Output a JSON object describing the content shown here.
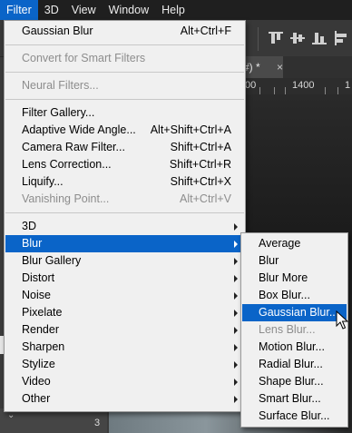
{
  "menubar": {
    "items": [
      {
        "label": "Filter",
        "active": true
      },
      {
        "label": "3D"
      },
      {
        "label": "View"
      },
      {
        "label": "Window"
      },
      {
        "label": "Help"
      }
    ]
  },
  "document": {
    "tab_label": "#) *",
    "close_glyph": "×",
    "ruler_labels": [
      "00",
      "1400",
      "1"
    ],
    "panel_number": "3",
    "panel_chevron": "⌄"
  },
  "filter_menu": {
    "last_filter": {
      "label": "Gaussian Blur",
      "shortcut": "Alt+Ctrl+F"
    },
    "convert_smart": {
      "label": "Convert for Smart Filters"
    },
    "neural_filters": {
      "label": "Neural Filters..."
    },
    "filter_gallery": {
      "label": "Filter Gallery..."
    },
    "adaptive_wide_angle": {
      "label": "Adaptive Wide Angle...",
      "shortcut": "Alt+Shift+Ctrl+A"
    },
    "camera_raw": {
      "label": "Camera Raw Filter...",
      "shortcut": "Shift+Ctrl+A"
    },
    "lens_correction": {
      "label": "Lens Correction...",
      "shortcut": "Shift+Ctrl+R"
    },
    "liquify": {
      "label": "Liquify...",
      "shortcut": "Shift+Ctrl+X"
    },
    "vanishing_point": {
      "label": "Vanishing Point...",
      "shortcut": "Alt+Ctrl+V"
    },
    "groups": [
      {
        "label": "3D"
      },
      {
        "label": "Blur"
      },
      {
        "label": "Blur Gallery"
      },
      {
        "label": "Distort"
      },
      {
        "label": "Noise"
      },
      {
        "label": "Pixelate"
      },
      {
        "label": "Render"
      },
      {
        "label": "Sharpen"
      },
      {
        "label": "Stylize"
      },
      {
        "label": "Video"
      },
      {
        "label": "Other"
      }
    ]
  },
  "blur_submenu": {
    "items": [
      {
        "label": "Average"
      },
      {
        "label": "Blur"
      },
      {
        "label": "Blur More"
      },
      {
        "label": "Box Blur..."
      },
      {
        "label": "Gaussian Blur..."
      },
      {
        "label": "Lens Blur..."
      },
      {
        "label": "Motion Blur..."
      },
      {
        "label": "Radial Blur..."
      },
      {
        "label": "Shape Blur..."
      },
      {
        "label": "Smart Blur..."
      },
      {
        "label": "Surface Blur..."
      }
    ]
  },
  "colors": {
    "highlight": "#0a64c8",
    "menu_bg": "#f0f0f0",
    "disabled_text": "#8d8d8d"
  }
}
